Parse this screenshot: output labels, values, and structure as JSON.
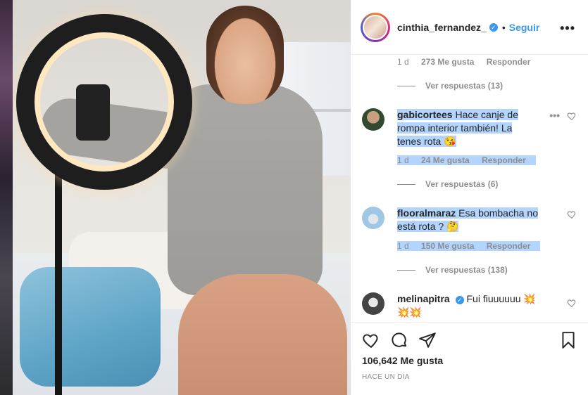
{
  "post": {
    "username": "cinthia_fernandez_",
    "separator": "•",
    "follow_label": "Seguir",
    "more_label": "•••"
  },
  "comments": [
    {
      "meta": {
        "age": "1 d",
        "likes": "273 Me gusta",
        "reply": "Responder"
      },
      "view_replies": "Ver respuestas (13)"
    },
    {
      "username": "gabicortees",
      "text": "Hace canje de rompa interior también! La tenes rota 😘",
      "more": "•••",
      "meta": {
        "age": "1 d",
        "likes": "24 Me gusta",
        "reply": "Responder"
      },
      "view_replies": "Ver respuestas (6)"
    },
    {
      "username": "flooralmaraz",
      "text": "Esa bombacha no está rota ? 🤔",
      "meta": {
        "age": "1 d",
        "likes": "150 Me gusta",
        "reply": "Responder"
      },
      "view_replies": "Ver respuestas (138)"
    },
    {
      "username": "melinapitra",
      "text": "Fui fiuuuuuu 💥💥💥"
    }
  ],
  "footer": {
    "likes": "106,642 Me gusta",
    "time": "HACE UN DÍA"
  },
  "colors": {
    "accent": "#3897f0",
    "selection": "#b3d4fd",
    "muted": "#8e8e8e",
    "text": "#262626"
  }
}
